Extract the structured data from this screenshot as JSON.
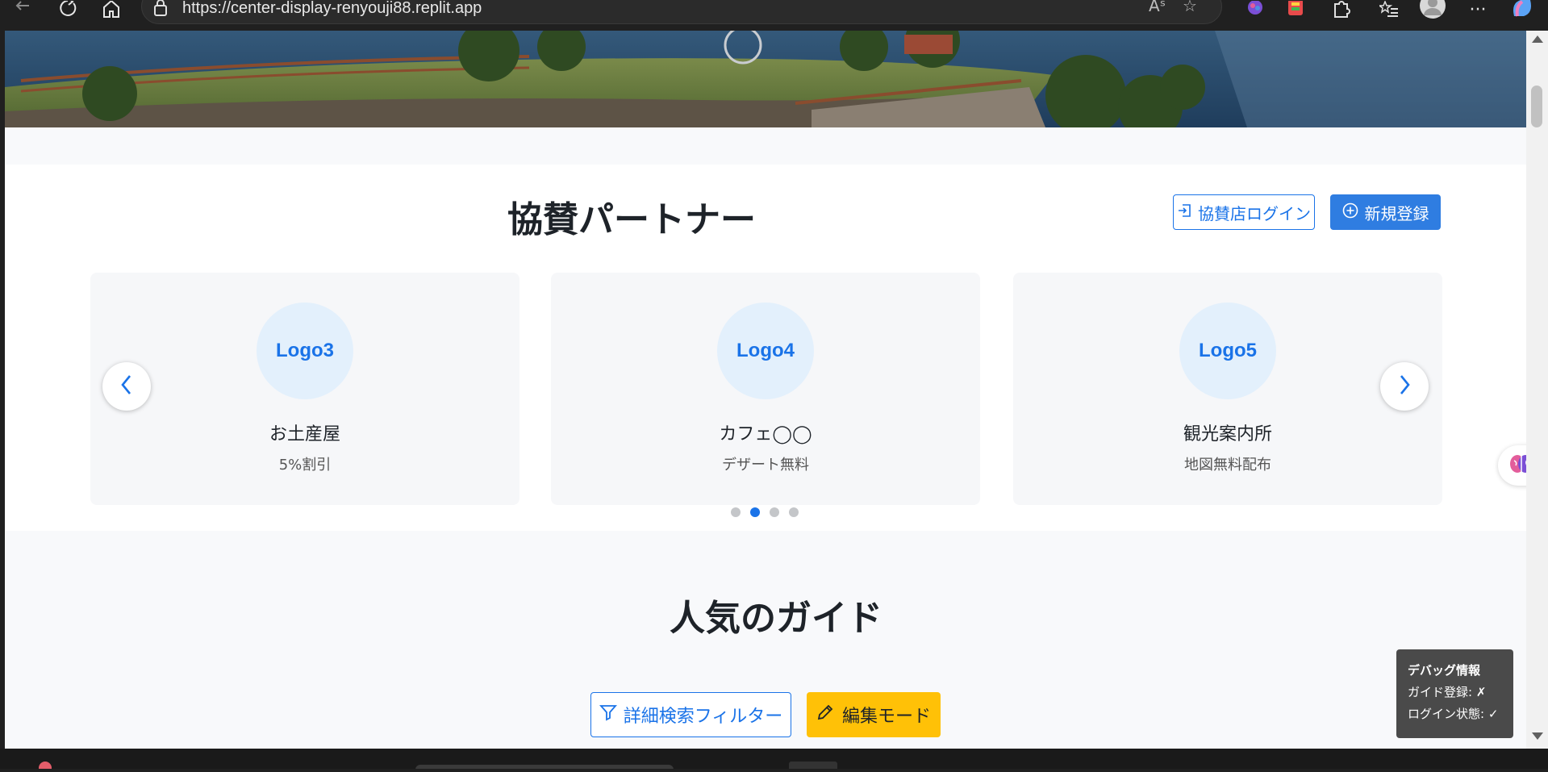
{
  "browser": {
    "url": "https://center-display-renyouji88.replit.app",
    "back_icon": "arrow-left-icon",
    "refresh_icon": "refresh-icon",
    "home_icon": "home-icon"
  },
  "partners": {
    "title": "協賛パートナー",
    "login_button": "協賛店ログイン",
    "register_button": "新規登録",
    "cards": [
      {
        "logo": "Logo3",
        "name": "お土産屋",
        "benefit": "5%割引"
      },
      {
        "logo": "Logo4",
        "name": "カフェ◯◯",
        "benefit": "デザート無料"
      },
      {
        "logo": "Logo5",
        "name": "観光案内所",
        "benefit": "地図無料配布"
      }
    ],
    "carousel_page_count": 4,
    "carousel_active_page": 2
  },
  "guides": {
    "title": "人気のガイド",
    "filter_button": "詳細検索フィルター",
    "edit_button": "編集モード"
  },
  "debug": {
    "title": "デバッグ情報",
    "guide_label": "ガイド登録: ✗",
    "login_label": "ログイン状態: ✓"
  },
  "colors": {
    "accent": "#1a73e8",
    "primary_button": "#2f7de1",
    "warning_button": "#ffc107",
    "debug_background": "#4a4a4a"
  }
}
